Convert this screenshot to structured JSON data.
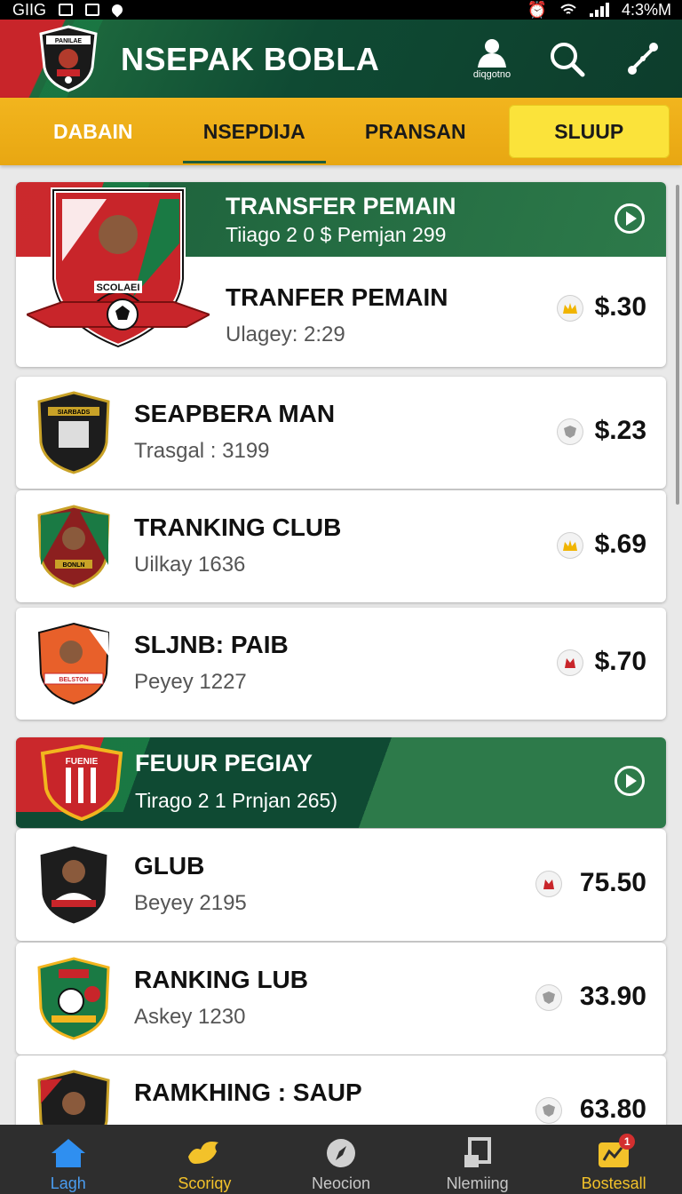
{
  "status_bar": {
    "left_text": "GIIG",
    "right_text": "4:3%M"
  },
  "header": {
    "title": "NSEPAK BOBLA",
    "profile_caption": "diqgotno",
    "logo_text": "PANILAE"
  },
  "tabs": [
    {
      "label": "DABAIN"
    },
    {
      "label": "NSEPDIJA"
    },
    {
      "label": "PRANSAN"
    },
    {
      "label": "SLUUP"
    }
  ],
  "featured_1": {
    "banner_title": "TRANSFER PEMAIN",
    "banner_subtitle": "Tiiago 2 0 $ Pemjan 299",
    "title": "TRANFER PEMAIN",
    "subtitle": "Ulagey: 2:29",
    "price": "$.30",
    "crest_text": "SCOLAEI"
  },
  "rows_1": [
    {
      "title": "SEAPBERA MAN",
      "subtitle": "Trasgal : 3199",
      "price": "$.23",
      "crest_text": "SIARBADS"
    },
    {
      "title": "TRANKING CLUB",
      "subtitle": "Uilkay 1636",
      "price": "$.69",
      "crest_text": "BONLN"
    },
    {
      "title": "SLJNB: PAIB",
      "subtitle": "Peyey 1227",
      "price": "$.70",
      "crest_text": "BELSTON"
    }
  ],
  "featured_2": {
    "banner_title": "FEUUR PEGIAY",
    "banner_subtitle": "Tirago 2 1 Prnjan 265)",
    "crest_text": "FUENIE"
  },
  "rows_2": [
    {
      "title": "GLUB",
      "subtitle": "Beyey 2195",
      "price": "75.50"
    },
    {
      "title": "RANKING LUB",
      "subtitle": "Askey 1230",
      "price": "33.90"
    },
    {
      "title": "RAMKHING : SAUP",
      "subtitle": "",
      "price": "63.80"
    }
  ],
  "bottom_nav": [
    {
      "label": "Lagh",
      "icon": "home-icon"
    },
    {
      "label": "Scoriqy",
      "icon": "bird-icon"
    },
    {
      "label": "Neocion",
      "icon": "compass-icon"
    },
    {
      "label": "Nlemiing",
      "icon": "board-icon"
    },
    {
      "label": "Bostesall",
      "icon": "wallet-icon",
      "badge": "1"
    }
  ],
  "colors": {
    "green": "#1b5e3a",
    "red": "#c8252a",
    "gold": "#f2b51e",
    "nav_active": "#4a9df0"
  }
}
